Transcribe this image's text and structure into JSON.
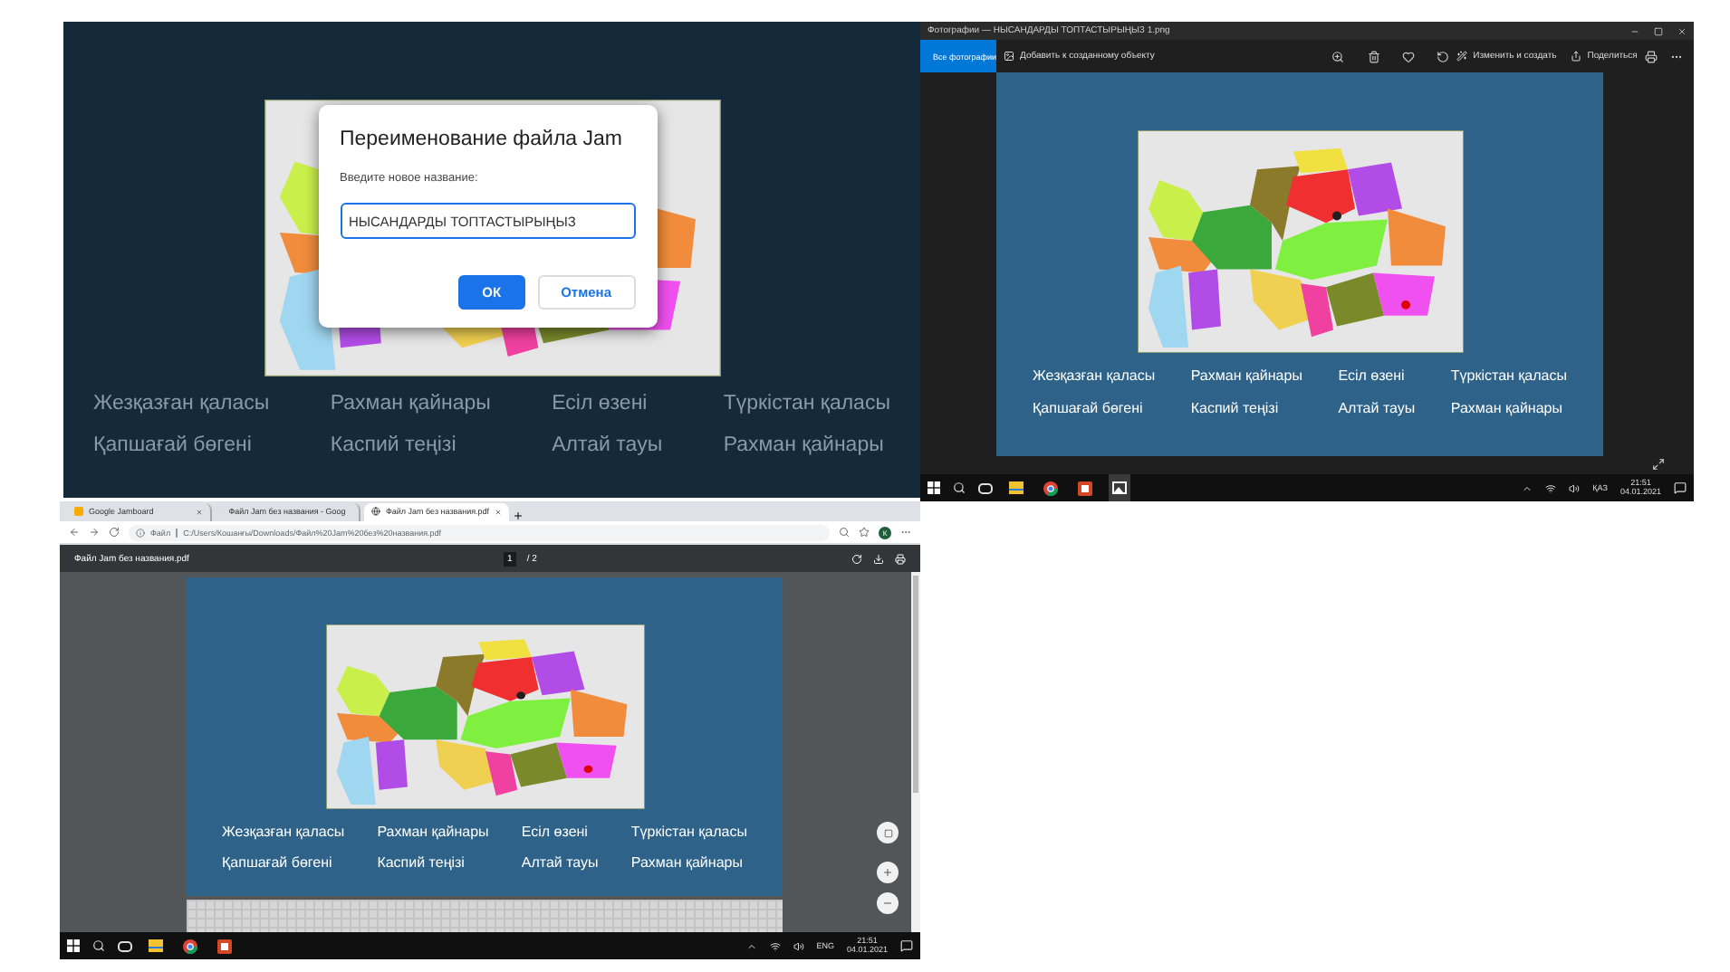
{
  "jamboard": {
    "dialog": {
      "title": "Переименование файла Jam",
      "prompt": "Введите новое название:",
      "value": "НЫСАНДАРДЫ ТОПТАСТЫРЫҢЫЗ",
      "buttons": [
        {
          "label": "ОК",
          "primary": true
        },
        {
          "label": "Отмена",
          "primary": false
        }
      ]
    },
    "labels": [
      "Жезқазған қаласы",
      "Рахман қайнары",
      "Есіл өзені",
      "Түркістан қаласы",
      "Қапшағай бөгені",
      "Каспий теңізі",
      "Алтай тауы",
      "Рахман қайнары"
    ]
  },
  "photos": {
    "title": "Фотографии — НЫСАНДАРДЫ ТОПТАСТЫРЫҢЫЗ 1.png",
    "all_photos": "Все фотографии",
    "add_to": "Добавить к созданному объекту",
    "edit": "Изменить и создать",
    "share": "Поделиться",
    "labels": [
      "Жезқазған қаласы",
      "Рахман қайнары",
      "Есіл өзені",
      "Түркістан қаласы",
      "Қапшағай бөгені",
      "Каспий теңізі",
      "Алтай тауы",
      "Рахман қайнары"
    ],
    "taskbar": {
      "language": "ҚАЗ",
      "time": "21:51",
      "date": "04.01.2021"
    }
  },
  "browser": {
    "tabs": [
      {
        "label": "Google Jamboard",
        "selected": false
      },
      {
        "label": "Файл Jam без названия - Goog",
        "selected": false
      },
      {
        "label": "Файл Jam без названия.pdf",
        "selected": true
      }
    ],
    "address_prefix": "Файл",
    "address": "C:/Users/Кошанғы/Downloads/Файл%20Jam%20без%20названия.pdf",
    "profile": "К",
    "pdf_title": "Файл Jam без названия.pdf",
    "page": "1",
    "page_total": "/ 2",
    "labels": [
      "Жезқазған қаласы",
      "Рахман қайнары",
      "Есіл өзені",
      "Түркістан қаласы",
      "Қапшағай бөгені",
      "Каспий теңізі",
      "Алтай тауы",
      "Рахман қайнары"
    ],
    "taskbar": {
      "language": "ENG",
      "time": "21:51",
      "date": "04.01.2021"
    }
  }
}
